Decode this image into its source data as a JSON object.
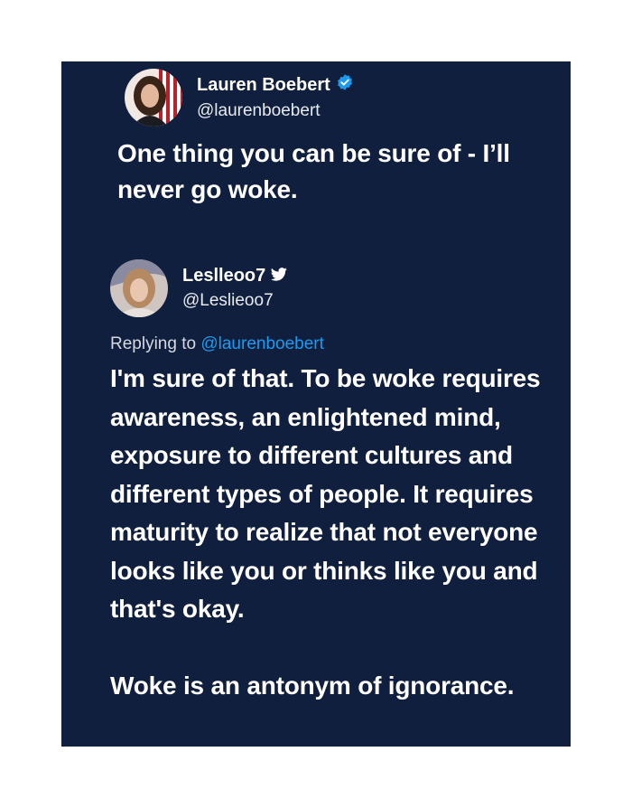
{
  "tweet1": {
    "display_name": "Lauren Boebert",
    "handle": "@laurenboebert",
    "verified": true,
    "text": "One thing you can be sure of - I’ll never go woke."
  },
  "tweet2": {
    "display_name": "Leslleoo7",
    "handle": "@Leslieoo7",
    "replying_prefix": "Replying to ",
    "replying_handle": "@laurenboebert",
    "paragraph1": "I'm sure of that. To be woke requires awareness, an enlightened mind, exposure to different cultures and different types of people. It requires maturity to realize that not everyone looks like you or thinks like you and that's okay.",
    "paragraph2": "Woke is an antonym of ignorance."
  },
  "colors": {
    "card_background": "#0f1f3d",
    "page_background": "#ffffff",
    "text": "#ffffff",
    "link": "#1d9bf0",
    "verified_badge": "#1d9bf0"
  },
  "icons": {
    "verified": "verified-badge-icon",
    "twitter": "twitter-bird-icon"
  }
}
